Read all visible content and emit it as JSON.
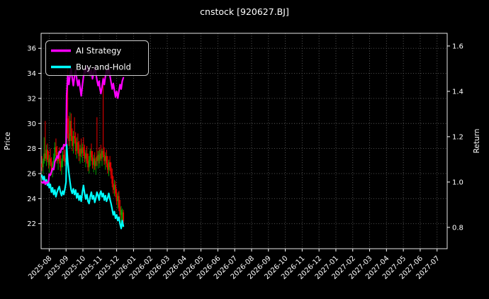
{
  "title": "cnstock [920627.BJ]",
  "colors": {
    "background": "#000000",
    "text": "#ffffff",
    "grid": "#5c5c5c",
    "spine": "#ffffff",
    "candle_up": "#00a000",
    "candle_down": "#ee0000",
    "ai_strategy": "#ff00ff",
    "buy_and_hold": "#00ffff"
  },
  "legend": {
    "items": [
      {
        "label": "AI Strategy",
        "color": "#ff00ff"
      },
      {
        "label": "Buy-and-Hold",
        "color": "#00ffff"
      }
    ]
  },
  "axes": {
    "left": {
      "label": "Price",
      "ticks": [
        22,
        24,
        26,
        28,
        30,
        32,
        34,
        36
      ],
      "lim": [
        20.0,
        37.2
      ]
    },
    "right": {
      "label": "Return",
      "ticks": [
        "0.8",
        "1.0",
        "1.2",
        "1.4",
        "1.6"
      ],
      "lim": [
        0.706,
        1.656
      ]
    },
    "x": {
      "lim_months": [
        -0.48,
        23.6
      ],
      "tick_labels": [
        "2025-08",
        "2025-09",
        "2025-10",
        "2025-11",
        "2025-12",
        "2026-01",
        "2026-02",
        "2026-03",
        "2026-04",
        "2026-05",
        "2026-06",
        "2026-07",
        "2026-08",
        "2026-09",
        "2026-10",
        "2026-11",
        "2026-12",
        "2027-01",
        "2027-02",
        "2027-03",
        "2027-04",
        "2027-05",
        "2027-06",
        "2027-07"
      ]
    }
  },
  "chart_data": {
    "type": "candlestick+line",
    "title": "cnstock [920627.BJ]",
    "xlabel": "",
    "ylabel_left": "Price",
    "ylabel_right": "Return",
    "grid": "dotted",
    "legend_position": "upper-left",
    "dates": [
      "2025-07-18",
      "2025-07-20",
      "2025-07-22",
      "2025-07-24",
      "2025-07-26",
      "2025-07-28",
      "2025-07-30",
      "2025-08-01",
      "2025-08-03",
      "2025-08-05",
      "2025-08-07",
      "2025-08-09",
      "2025-08-11",
      "2025-08-13",
      "2025-08-15",
      "2025-08-17",
      "2025-08-19",
      "2025-08-21",
      "2025-08-23",
      "2025-08-25",
      "2025-08-27",
      "2025-08-29",
      "2025-08-31",
      "2025-09-02",
      "2025-09-04",
      "2025-09-06",
      "2025-09-08",
      "2025-09-10",
      "2025-09-12",
      "2025-09-14",
      "2025-09-16",
      "2025-09-18",
      "2025-09-20",
      "2025-09-22",
      "2025-09-24",
      "2025-09-26",
      "2025-09-28",
      "2025-09-30",
      "2025-10-02",
      "2025-10-04",
      "2025-10-06",
      "2025-10-08",
      "2025-10-10",
      "2025-10-12",
      "2025-10-14",
      "2025-10-16",
      "2025-10-18",
      "2025-10-20",
      "2025-10-22",
      "2025-10-24",
      "2025-10-26",
      "2025-10-28",
      "2025-10-30",
      "2025-11-01",
      "2025-11-03",
      "2025-11-05",
      "2025-11-07",
      "2025-11-09",
      "2025-11-11",
      "2025-11-13",
      "2025-11-15",
      "2025-11-17",
      "2025-11-19",
      "2025-11-21",
      "2025-11-23",
      "2025-11-25",
      "2025-11-27",
      "2025-11-29",
      "2025-12-01",
      "2025-12-03",
      "2025-12-05",
      "2025-12-07",
      "2025-12-09",
      "2025-12-11",
      "2025-12-13"
    ],
    "ohlc": [
      [
        26.8,
        27.4,
        26.2,
        26.5
      ],
      [
        26.5,
        27.2,
        26.0,
        27.0
      ],
      [
        27.0,
        28.9,
        26.8,
        27.6
      ],
      [
        27.6,
        30.2,
        27.0,
        27.2
      ],
      [
        27.2,
        28.3,
        26.6,
        27.9
      ],
      [
        27.9,
        28.4,
        26.9,
        27.1
      ],
      [
        27.1,
        27.8,
        26.4,
        26.7
      ],
      [
        26.7,
        27.5,
        26.1,
        27.2
      ],
      [
        27.2,
        28.0,
        26.6,
        26.9
      ],
      [
        26.9,
        27.3,
        25.9,
        26.2
      ],
      [
        26.2,
        27.0,
        25.7,
        26.8
      ],
      [
        26.8,
        27.6,
        26.3,
        27.3
      ],
      [
        27.3,
        28.5,
        26.9,
        28.1
      ],
      [
        28.1,
        28.8,
        27.4,
        27.7
      ],
      [
        27.7,
        28.2,
        26.8,
        27.0
      ],
      [
        27.0,
        27.7,
        26.3,
        27.4
      ],
      [
        27.4,
        28.1,
        26.8,
        27.0
      ],
      [
        27.0,
        27.5,
        26.2,
        26.5
      ],
      [
        26.5,
        27.2,
        25.9,
        27.0
      ],
      [
        27.0,
        27.8,
        26.5,
        27.5
      ],
      [
        27.5,
        28.3,
        27.0,
        27.2
      ],
      [
        27.2,
        27.9,
        26.6,
        26.9
      ],
      [
        26.9,
        27.6,
        26.4,
        27.3
      ],
      [
        27.5,
        31.0,
        27.2,
        30.4
      ],
      [
        30.4,
        34.5,
        28.8,
        29.2
      ],
      [
        29.2,
        30.6,
        28.2,
        28.6
      ],
      [
        28.6,
        30.9,
        28.0,
        30.2
      ],
      [
        30.2,
        30.8,
        28.6,
        29.0
      ],
      [
        29.0,
        29.6,
        27.8,
        28.2
      ],
      [
        28.2,
        29.4,
        27.6,
        29.0
      ],
      [
        29.0,
        30.5,
        28.4,
        28.8
      ],
      [
        28.8,
        29.3,
        27.5,
        27.8
      ],
      [
        27.8,
        28.9,
        27.2,
        28.5
      ],
      [
        28.5,
        29.2,
        27.6,
        27.9
      ],
      [
        27.9,
        28.6,
        27.0,
        27.4
      ],
      [
        27.4,
        28.3,
        26.8,
        28.0
      ],
      [
        28.0,
        28.8,
        27.3,
        27.6
      ],
      [
        27.6,
        28.4,
        26.9,
        28.1
      ],
      [
        28.1,
        28.9,
        27.4,
        27.7
      ],
      [
        27.7,
        28.3,
        26.9,
        27.2
      ],
      [
        27.2,
        27.9,
        26.5,
        27.6
      ],
      [
        27.6,
        28.2,
        26.8,
        27.0
      ],
      [
        27.0,
        27.6,
        26.2,
        26.5
      ],
      [
        26.5,
        27.4,
        26.0,
        27.1
      ],
      [
        27.1,
        28.0,
        26.6,
        27.8
      ],
      [
        27.8,
        28.4,
        27.0,
        27.3
      ],
      [
        27.3,
        27.8,
        26.4,
        26.7
      ],
      [
        26.7,
        27.5,
        26.1,
        27.2
      ],
      [
        27.2,
        27.7,
        26.3,
        26.6
      ],
      [
        26.6,
        27.3,
        25.9,
        27.0
      ],
      [
        27.4,
        30.5,
        26.6,
        27.0
      ],
      [
        27.0,
        27.8,
        26.4,
        27.5
      ],
      [
        27.5,
        28.1,
        26.8,
        27.1
      ],
      [
        27.1,
        27.9,
        26.5,
        27.6
      ],
      [
        27.6,
        28.3,
        27.0,
        27.2
      ],
      [
        27.2,
        28.0,
        26.6,
        27.8
      ],
      [
        27.8,
        33.7,
        27.3,
        27.5
      ],
      [
        27.5,
        28.1,
        26.7,
        27.0
      ],
      [
        27.0,
        27.7,
        26.3,
        27.4
      ],
      [
        27.4,
        27.9,
        26.5,
        26.8
      ],
      [
        26.8,
        27.4,
        26.0,
        26.3
      ],
      [
        26.3,
        27.1,
        25.8,
        26.9
      ],
      [
        26.9,
        27.4,
        26.2,
        26.5
      ],
      [
        26.5,
        26.9,
        25.6,
        25.9
      ],
      [
        25.9,
        26.4,
        24.9,
        25.2
      ],
      [
        25.2,
        25.8,
        24.4,
        24.7
      ],
      [
        24.7,
        25.5,
        24.2,
        25.1
      ],
      [
        25.1,
        25.4,
        24.1,
        24.4
      ],
      [
        24.4,
        24.8,
        23.5,
        23.8
      ],
      [
        23.8,
        24.5,
        23.2,
        24.2
      ],
      [
        24.2,
        24.6,
        23.0,
        23.3
      ],
      [
        23.3,
        23.9,
        22.4,
        22.7
      ],
      [
        22.7,
        23.4,
        22.0,
        23.1
      ],
      [
        22.0,
        23.2,
        21.7,
        22.9
      ],
      [
        22.9,
        23.1,
        21.9,
        22.2
      ]
    ],
    "series": [
      {
        "name": "AI Strategy",
        "axis": "right",
        "color": "#ff00ff",
        "values": [
          1.0,
          0.995,
          1.005,
          0.99,
          1.0,
          0.995,
          1.005,
          1.035,
          1.03,
          1.045,
          1.06,
          1.055,
          1.09,
          1.1,
          1.115,
          1.105,
          1.135,
          1.13,
          1.15,
          1.145,
          1.165,
          1.16,
          1.17,
          1.38,
          1.47,
          1.43,
          1.47,
          1.5,
          1.46,
          1.425,
          1.465,
          1.495,
          1.455,
          1.425,
          1.45,
          1.415,
          1.38,
          1.425,
          1.465,
          1.495,
          1.48,
          1.51,
          1.48,
          1.5,
          1.47,
          1.495,
          1.455,
          1.48,
          1.505,
          1.48,
          1.45,
          1.425,
          1.445,
          1.415,
          1.39,
          1.42,
          1.455,
          1.43,
          1.465,
          1.495,
          1.475,
          1.5,
          1.47,
          1.44,
          1.41,
          1.435,
          1.405,
          1.375,
          1.4,
          1.37,
          1.4,
          1.43,
          1.41,
          1.445,
          1.46
        ]
      },
      {
        "name": "Buy-and-Hold",
        "axis": "right",
        "color": "#00ffff",
        "values": [
          1.03,
          1.01,
          1.025,
          0.995,
          1.01,
          0.985,
          1.0,
          0.975,
          0.99,
          0.955,
          0.975,
          0.945,
          0.965,
          0.935,
          0.955,
          0.97,
          0.98,
          0.955,
          0.94,
          0.96,
          0.945,
          0.97,
          1.0,
          1.165,
          1.09,
          1.04,
          1.0,
          0.965,
          0.95,
          0.97,
          0.945,
          0.965,
          0.93,
          0.95,
          0.92,
          0.94,
          0.915,
          0.955,
          0.985,
          0.95,
          0.925,
          0.945,
          0.915,
          0.905,
          0.935,
          0.955,
          0.925,
          0.94,
          0.91,
          0.93,
          0.955,
          0.94,
          0.92,
          0.945,
          0.96,
          0.935,
          0.95,
          0.92,
          0.94,
          0.915,
          0.93,
          0.95,
          0.925,
          0.905,
          0.88,
          0.855,
          0.87,
          0.84,
          0.855,
          0.83,
          0.845,
          0.815,
          0.795,
          0.83,
          0.805
        ]
      }
    ]
  }
}
